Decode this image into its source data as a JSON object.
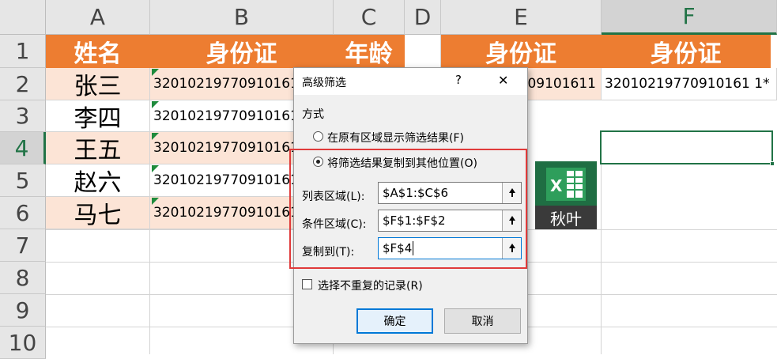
{
  "columns": [
    "A",
    "B",
    "C",
    "D",
    "E",
    "F"
  ],
  "rows": [
    "1",
    "2",
    "3",
    "4",
    "5",
    "6",
    "7",
    "8",
    "9",
    "10"
  ],
  "header_row": {
    "name": "姓名",
    "id_card": "身份证",
    "age": "年龄",
    "e": "身份证",
    "f": "身份证"
  },
  "people": [
    {
      "name": "张三",
      "id": "32010219770910161"
    },
    {
      "name": "李四",
      "id": "32010219770910161"
    },
    {
      "name": "王五",
      "id": "32010219770910161"
    },
    {
      "name": "赵六",
      "id": "32010219770910161"
    },
    {
      "name": "马七",
      "id": "32010219770910161"
    }
  ],
  "criteria": {
    "e2": "09101611",
    "f2": "32010219770910161 1*"
  },
  "dialog": {
    "title": "高级筛选",
    "help": "?",
    "close": "✕",
    "section": "方式",
    "option1": "在原有区域显示筛选结果(F)",
    "option2": "将筛选结果复制到其他位置(O)",
    "selected_option": 2,
    "list_range_label": "列表区域(L):",
    "list_range_value": "$A$1:$C$6",
    "criteria_range_label": "条件区域(C):",
    "criteria_range_value": "$F$1:$F$2",
    "copy_to_label": "复制到(T):",
    "copy_to_value": "$F$4",
    "unique_label": "选择不重复的记录(R)",
    "unique_checked": false,
    "ok": "确定",
    "cancel": "取消"
  },
  "watermark": {
    "text": "秋叶"
  },
  "colors": {
    "accent_orange": "#ed7d31",
    "peach": "#fce4d6",
    "excel_green": "#217346",
    "highlight_red": "#e03a3a",
    "focus_blue": "#0078d7"
  }
}
